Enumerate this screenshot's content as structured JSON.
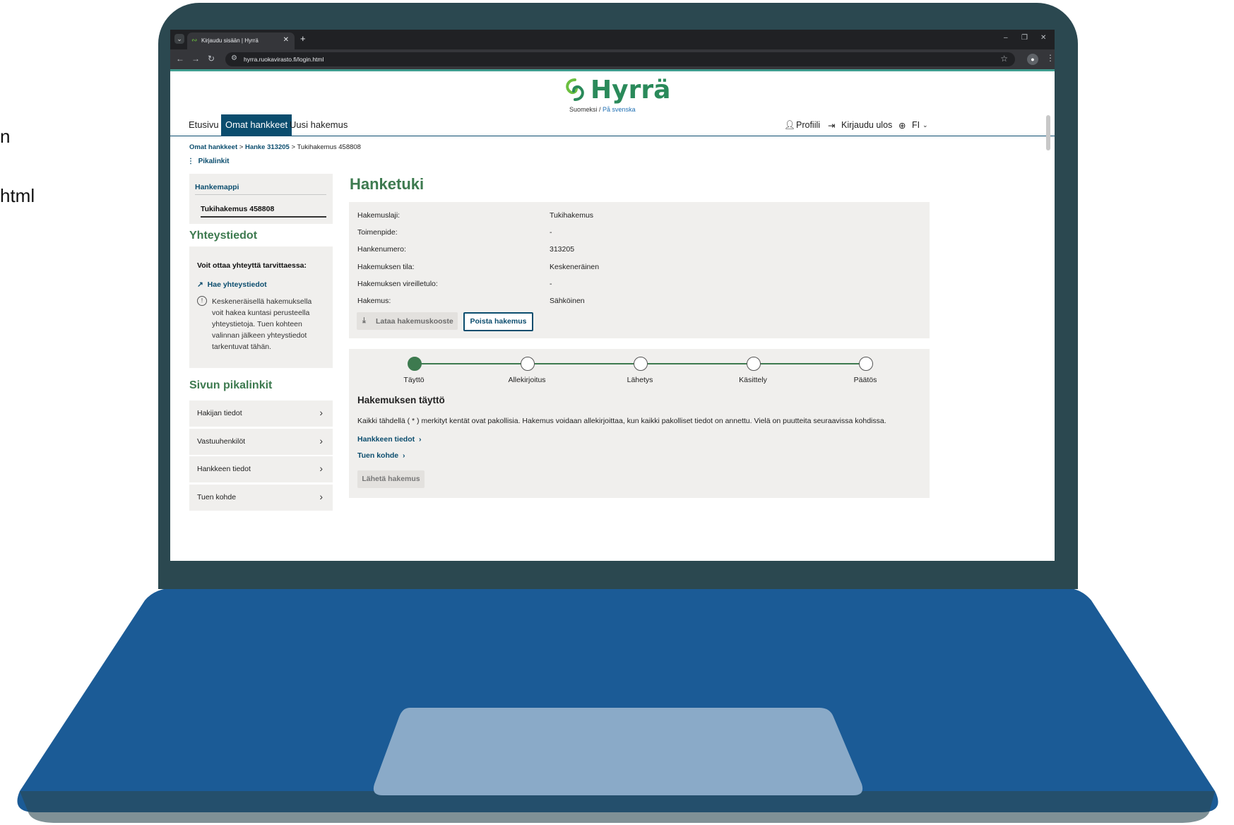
{
  "background": {
    "text_line1": "n",
    "text_line2": "html"
  },
  "browser": {
    "tab_title": "Kirjaudu sisään | Hyrrä",
    "tab_close": "✕",
    "new_tab": "+",
    "win_min": "–",
    "win_max": "❐",
    "win_close": "✕",
    "url": "hyrra.ruokavirasto.fi/login.html"
  },
  "site": {
    "logo_text": "Hyrrä",
    "lang_fi": "Suomeksi /",
    "lang_sv": "På svenska"
  },
  "nav": {
    "home": "Etusivu",
    "my_projects": "Omat hankkeet",
    "new_application": "Uusi hakemus",
    "profile": "Profiili",
    "logout": "Kirjaudu ulos",
    "language": "FI"
  },
  "breadcrumb": {
    "item1": "Omat hankkeet",
    "item2": "Hanke 313205",
    "item3": "Tukihakemus 458808"
  },
  "quick_links_toggle": "Pikalinkit",
  "sidebar": {
    "folder_title": "Hankemappi",
    "folder_selected": "Tukihakemus 458808",
    "contact_heading": "Yhteystiedot",
    "contact_question": "Voit ottaa yhteyttä tarvittaessa:",
    "contact_link": "Hae yhteystiedot",
    "contact_info": "Keskeneräisellä hakemuksella voit hakea kuntasi perusteella yhteystietoja. Tuen kohteen valinnan jälkeen yhteystiedot tarkentuvat tähän.",
    "quicklinks_heading": "Sivun pikalinkit",
    "quicklinks": [
      {
        "label": "Hakijan tiedot"
      },
      {
        "label": "Vastuuhenkilöt"
      },
      {
        "label": "Hankkeen tiedot"
      },
      {
        "label": "Tuen kohde"
      }
    ]
  },
  "main": {
    "title": "Hanketuki",
    "details": [
      {
        "label": "Hakemuslaji:",
        "value": "Tukihakemus"
      },
      {
        "label": "Toimenpide:",
        "value": "-"
      },
      {
        "label": "Hankenumero:",
        "value": "313205"
      },
      {
        "label": "Hakemuksen tila:",
        "value": "Keskeneräinen"
      },
      {
        "label": "Hakemuksen vireilletulo:",
        "value": "-"
      },
      {
        "label": "Hakemus:",
        "value": "Sähköinen"
      }
    ],
    "download_button": "Lataa hakemuskooste",
    "delete_button": "Poista hakemus",
    "steps": [
      {
        "label": "Täyttö",
        "done": true
      },
      {
        "label": "Allekirjoitus",
        "done": false
      },
      {
        "label": "Lähetys",
        "done": false
      },
      {
        "label": "Käsittely",
        "done": false
      },
      {
        "label": "Päätös",
        "done": false
      }
    ],
    "fill_heading": "Hakemuksen täyttö",
    "fill_text": "Kaikki tähdellä ( * ) merkityt kentät ovat pakollisia. Hakemus voidaan allekirjoittaa, kun kaikki pakolliset tiedot on annettu. Vielä on puutteita seuraavissa kohdissa.",
    "missing_links": [
      "Hankkeen tiedot",
      "Tuen kohde"
    ],
    "send_button": "Lähetä hakemus"
  },
  "colors": {
    "laptop_body": "#2b4850",
    "laptop_base": "#1b5b96",
    "touchpad": "#8aaac8",
    "accent_blue": "#0b4d6e",
    "accent_green": "#3d7a4f"
  }
}
